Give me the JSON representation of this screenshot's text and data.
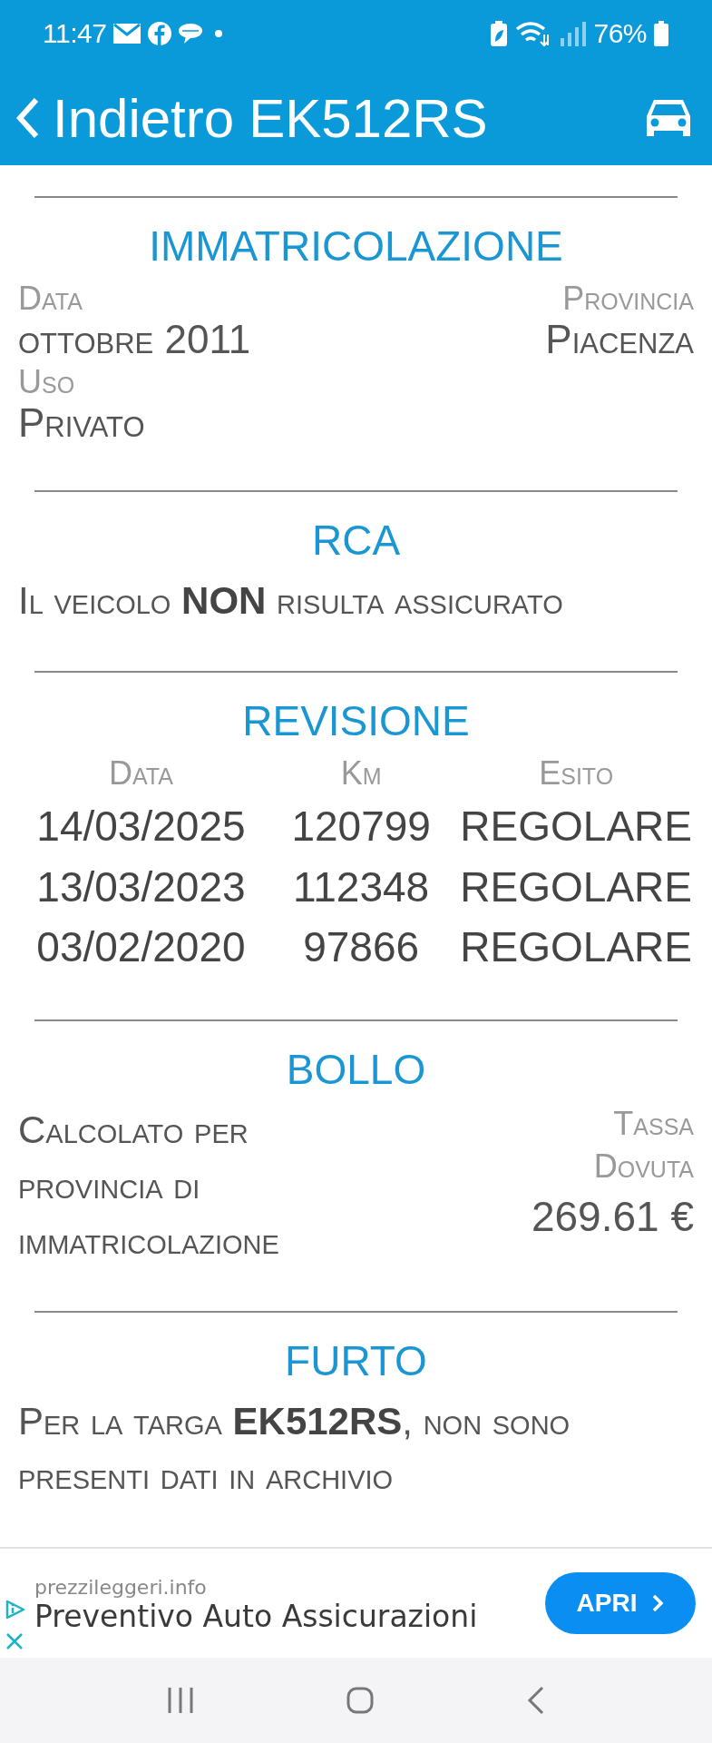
{
  "status_bar": {
    "time": "11:47",
    "battery": "76%"
  },
  "title_bar": {
    "back": "Indietro",
    "title": "EK512RS"
  },
  "sections": [
    {
      "kind": "fields",
      "title": "IMMATRICOLAZIONE",
      "rows": [
        [
          {
            "label": "Data",
            "value": "ottobre 2011"
          },
          {
            "label": "Provincia",
            "value": "Piacenza"
          }
        ],
        [
          {
            "label": "Uso",
            "value": "Privato"
          }
        ]
      ]
    },
    {
      "kind": "text",
      "title": "RCA",
      "text": "Il veicolo **NON** risulta assicurato"
    },
    {
      "kind": "table",
      "title": "REVISIONE",
      "columns": [
        "Data",
        "Km",
        "Esito"
      ],
      "rows": [
        [
          "14/03/2025",
          "120799",
          "REGOLARE"
        ],
        [
          "13/03/2023",
          "112348",
          "REGOLARE"
        ],
        [
          "03/02/2020",
          "97866",
          "REGOLARE"
        ]
      ]
    },
    {
      "kind": "tax",
      "title": "BOLLO",
      "text": "Calcolato per provincia di immatricolazione",
      "label": "Tassa Dovuta",
      "amount": "269.61 €"
    },
    {
      "kind": "text",
      "title": "FURTO",
      "text": "Per la targa **EK512RS**, non sono presenti dati in archivio"
    }
  ],
  "ad": {
    "domain": "prezzileggeri.info",
    "headline": "Preventivo Auto Assicurazioni",
    "button": "APRI"
  }
}
